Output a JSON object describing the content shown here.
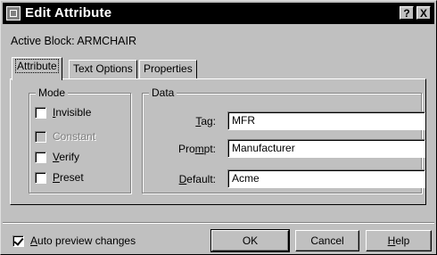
{
  "window": {
    "title": "Edit Attribute",
    "help_button": "?",
    "close_button": "X"
  },
  "active_block": {
    "text": "Active Block: ARMCHAIR"
  },
  "tabs": [
    {
      "label": "Attribute",
      "active": true
    },
    {
      "label": "Text Options",
      "active": false
    },
    {
      "label": "Properties",
      "active": false
    }
  ],
  "mode": {
    "title": "Mode",
    "invisible": {
      "label_pre": "",
      "label_key": "I",
      "label_post": "nvisible",
      "checked": false,
      "enabled": true
    },
    "constant": {
      "label": "Constant",
      "checked": false,
      "enabled": false
    },
    "verify": {
      "label_pre": "",
      "label_key": "V",
      "label_post": "erify",
      "checked": false,
      "enabled": true
    },
    "preset": {
      "label_pre": "",
      "label_key": "P",
      "label_post": "reset",
      "checked": false,
      "enabled": true
    }
  },
  "data": {
    "title": "Data",
    "tag": {
      "label_pre": "",
      "label_key": "T",
      "label_post": "ag:",
      "value": "MFR"
    },
    "prompt": {
      "label_pre": "Pro",
      "label_key": "m",
      "label_post": "pt:",
      "value": "Manufacturer"
    },
    "default": {
      "label_pre": "",
      "label_key": "D",
      "label_post": "efault:",
      "value": "Acme"
    }
  },
  "auto_preview": {
    "label_pre": "",
    "label_key": "A",
    "label_post": "uto preview changes",
    "checked": true
  },
  "buttons": {
    "ok": "OK",
    "cancel": "Cancel",
    "help_pre": "",
    "help_key": "H",
    "help_post": "elp"
  }
}
